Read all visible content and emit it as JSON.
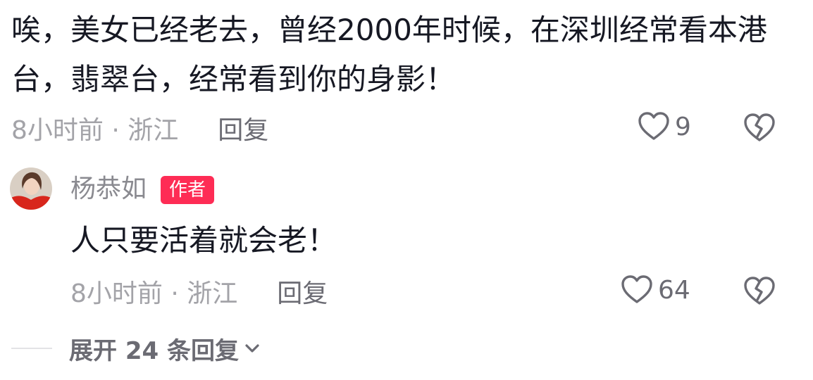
{
  "comment": {
    "text": "唉，美女已经老去，曾经2000年时候，在深圳经常看本港台，翡翠台，经常看到你的身影！",
    "time_location": "8小时前 · 浙江",
    "reply_label": "回复",
    "like_count": "9",
    "like_icon": "heart-outline",
    "dislike_icon": "broken-heart"
  },
  "author_reply": {
    "author_name": "杨恭如",
    "badge_label": "作者",
    "badge_color": "#fe2c55",
    "text": "人只要活着就会老！",
    "time_location": "8小时前 · 浙江",
    "reply_label": "回复",
    "like_count": "64"
  },
  "expand": {
    "label": "展开 24 条回复"
  }
}
